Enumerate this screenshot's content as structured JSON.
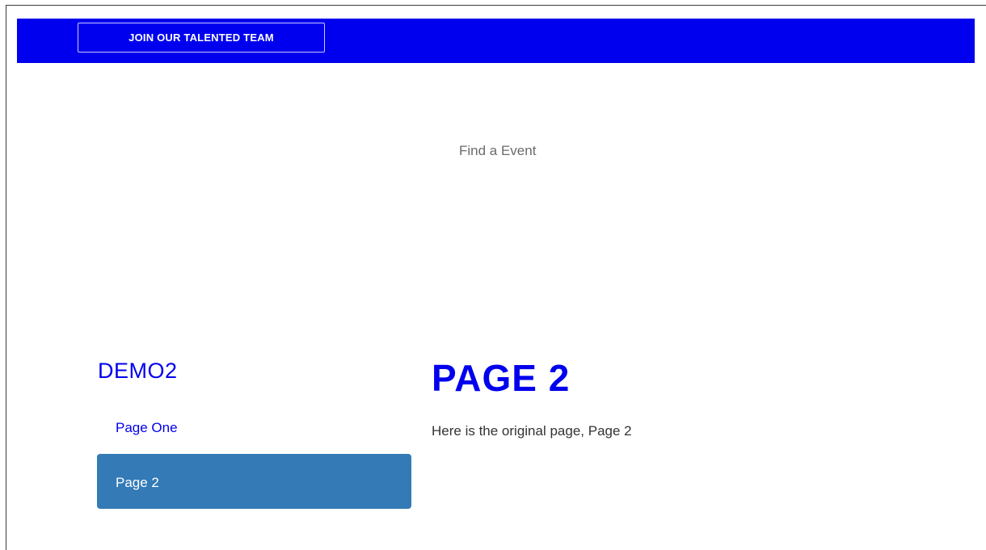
{
  "header": {
    "join_button_label": "JOIN OUR TALENTED TEAM",
    "background_color": "#0000ee"
  },
  "search": {
    "find_event_label": "Find a Event"
  },
  "sidebar": {
    "title": "DEMO2",
    "items": [
      {
        "label": "Page One",
        "active": false
      },
      {
        "label": "Page 2",
        "active": true
      }
    ],
    "active_color": "#337ab7"
  },
  "main": {
    "heading": "PAGE 2",
    "body_text": "Here is the original page, Page 2"
  }
}
